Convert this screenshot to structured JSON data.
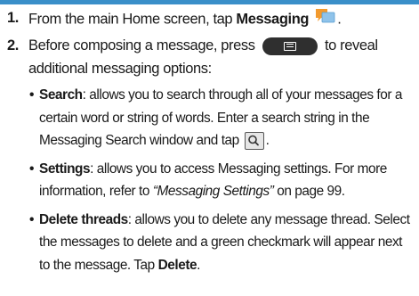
{
  "colors": {
    "accent_rule": "#3a8fc9",
    "messaging_icon_orange": "#f29a2e",
    "messaging_icon_blue": "#8fc3ea",
    "menu_key_bg": "#2f2f2f"
  },
  "steps": [
    {
      "number": "1.",
      "text_before": "From the main Home screen, tap ",
      "bold": "Messaging",
      "icon": "messaging-app-icon",
      "text_after": "."
    },
    {
      "number": "2.",
      "text_before": "Before composing a message, press",
      "icon": "menu-key-icon",
      "text_after": "to reveal additional messaging options:"
    }
  ],
  "options": [
    {
      "term": "Search",
      "desc_before": ": allows you to search through all of your messages for a certain word or string of words. Enter a search string in the Messaging Search window and tap",
      "icon": "search-key-icon",
      "desc_after": "."
    },
    {
      "term": "Settings",
      "desc_before": ": allows you to access Messaging settings. For more information, refer to ",
      "xref": "“Messaging Settings”",
      "page_text": " on page 99."
    },
    {
      "term": "Delete threads",
      "desc_before": ": allows you to delete any message thread. Select the messages to delete and a green checkmark will appear next to the message. Tap ",
      "bold_end": "Delete",
      "desc_after": "."
    }
  ]
}
